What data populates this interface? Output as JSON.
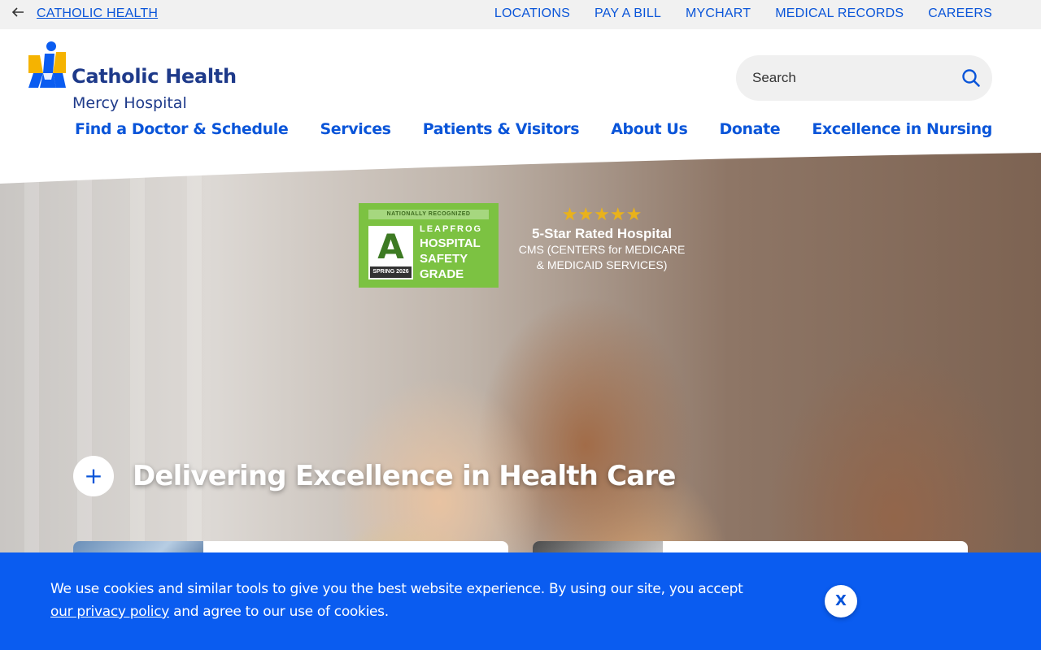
{
  "utility": {
    "back_icon": "arrow-left-icon",
    "back_label": "CATHOLIC HEALTH",
    "links": [
      "LOCATIONS",
      "PAY A BILL",
      "MYCHART",
      "MEDICAL RECORDS",
      "CAREERS"
    ]
  },
  "logo": {
    "title": "Catholic Health",
    "subtitle": "Mercy Hospital",
    "colors": {
      "yellow": "#f5b301",
      "blue": "#0a5cf0",
      "navy": "#1e3a8a"
    }
  },
  "search": {
    "placeholder": "Search",
    "icon": "search-icon"
  },
  "main_nav": [
    "Find a Doctor & Schedule",
    "Services",
    "Patients & Visitors",
    "About Us",
    "Donate",
    "Excellence in Nursing"
  ],
  "hero": {
    "leapfrog": {
      "top": "NATIONALLY RECOGNIZED",
      "grade": "A",
      "season": "SPRING 2026",
      "name": "LEAPFROG",
      "line1": "HOSPITAL",
      "line2": "SAFETY",
      "line3": "GRADE"
    },
    "cms": {
      "stars": "★★★★★",
      "title": "5-Star Rated Hospital",
      "line1": "CMS (CENTERS for MEDICARE",
      "line2": "& MEDICAID SERVICES)"
    },
    "expand_icon": "plus-icon",
    "expand_label": "+",
    "title": "Delivering Excellence in Health Care"
  },
  "cookie": {
    "text_before": "We use cookies and similar tools to give you the best website experience. By using our site, you accept ",
    "link": "our privacy policy",
    "text_after": " and agree to our use of cookies.",
    "close_label": "X"
  },
  "colors": {
    "link_blue": "#0a55d9",
    "banner_blue": "#0a5cf0",
    "leapfrog_green": "#7cc242",
    "star_gold": "#e9b21b"
  }
}
